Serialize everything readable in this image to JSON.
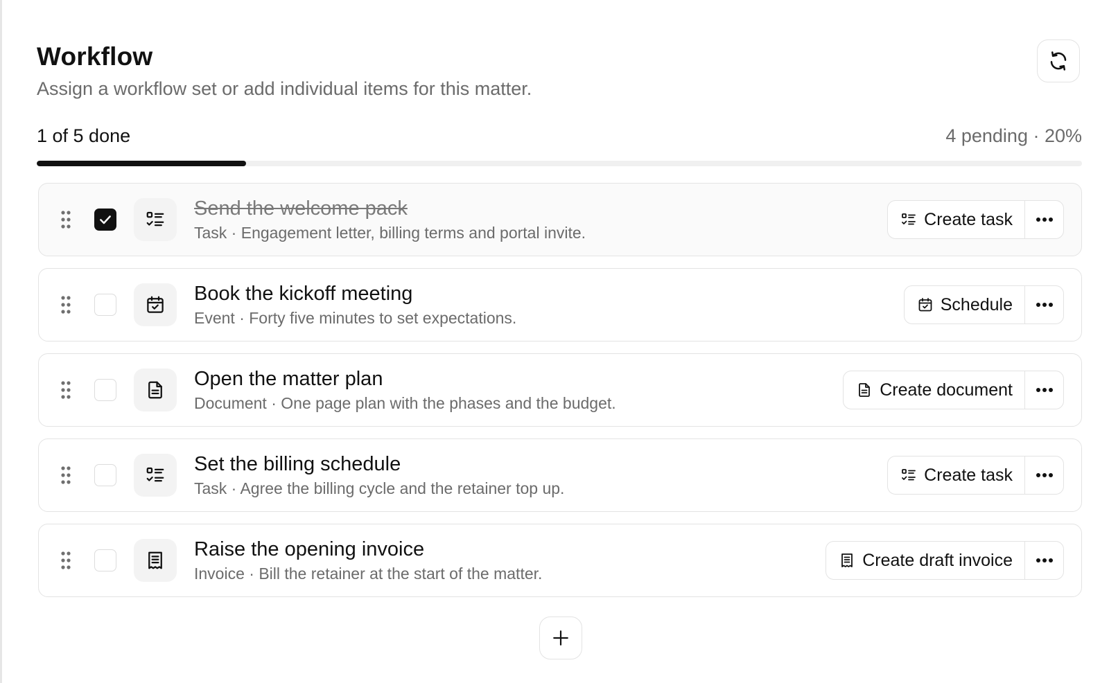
{
  "header": {
    "title": "Workflow",
    "subtitle": "Assign a workflow set or add individual items for this matter.",
    "refresh_icon": "refresh-icon"
  },
  "progress": {
    "done_label": "1 of 5 done",
    "meta_label": "4 pending · 20%",
    "fraction": 0.2
  },
  "colors": {
    "accent": "#111111",
    "muted_text": "#6b6b6b",
    "border": "#e3e3e3"
  },
  "items": [
    {
      "title": "Send the welcome pack",
      "subtitle": "Task · Engagement letter, billing terms and portal invite.",
      "type_icon": "task-list-icon",
      "checked": true,
      "action_label": "Create task",
      "action_icon": "task-list-icon"
    },
    {
      "title": "Book the kickoff meeting",
      "subtitle": "Event · Forty five minutes to set expectations.",
      "type_icon": "calendar-check-icon",
      "checked": false,
      "action_label": "Schedule",
      "action_icon": "calendar-check-icon"
    },
    {
      "title": "Open the matter plan",
      "subtitle": "Document · One page plan with the phases and the budget.",
      "type_icon": "document-icon",
      "checked": false,
      "action_label": "Create document",
      "action_icon": "document-icon"
    },
    {
      "title": "Set the billing schedule",
      "subtitle": "Task · Agree the billing cycle and the retainer top up.",
      "type_icon": "task-list-icon",
      "checked": false,
      "action_label": "Create task",
      "action_icon": "task-list-icon"
    },
    {
      "title": "Raise the opening invoice",
      "subtitle": "Invoice · Bill the retainer at the start of the matter.",
      "type_icon": "receipt-icon",
      "checked": false,
      "action_label": "Create draft invoice",
      "action_icon": "receipt-icon"
    }
  ],
  "add_button_icon": "plus-icon"
}
